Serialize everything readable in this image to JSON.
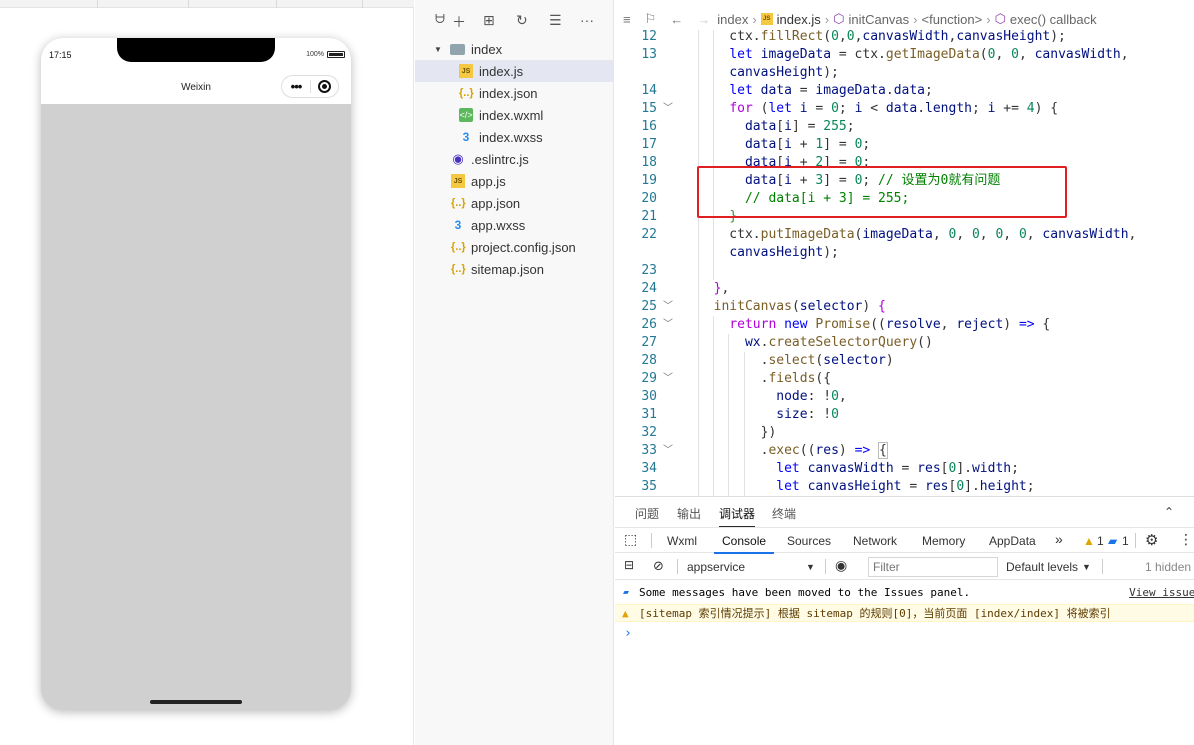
{
  "simulator": {
    "time": "17:15",
    "battery": "100%",
    "nav_title": "Weixin",
    "capsule_more": "•••"
  },
  "explorer": {
    "items": [
      {
        "name": "index",
        "type": "folder"
      },
      {
        "name": "index.js",
        "type": "js",
        "selected": true
      },
      {
        "name": "index.json",
        "type": "json"
      },
      {
        "name": "index.wxml",
        "type": "wxml"
      },
      {
        "name": "index.wxss",
        "type": "wxss"
      },
      {
        "name": ".eslintrc.js",
        "type": "eslint"
      },
      {
        "name": "app.js",
        "type": "js"
      },
      {
        "name": "app.json",
        "type": "json"
      },
      {
        "name": "app.wxss",
        "type": "wxss"
      },
      {
        "name": "project.config.json",
        "type": "json"
      },
      {
        "name": "sitemap.json",
        "type": "json"
      }
    ],
    "icon_labels": {
      "js": "JS",
      "json": "{..}",
      "wxml": "</>",
      "wxss": "3"
    }
  },
  "editor": {
    "breadcrumb": [
      "index",
      "index.js",
      "initCanvas",
      "<function>",
      "exec() callback"
    ],
    "line_numbers": [
      "12",
      "13",
      "",
      "14",
      "15",
      "16",
      "17",
      "18",
      "19",
      "20",
      "21",
      "22",
      "",
      "23",
      "24",
      "25",
      "26",
      "27",
      "28",
      "29",
      "30",
      "31",
      "32",
      "33",
      "34",
      "35"
    ],
    "code": [
      "    ctx.fillRect(0,0,canvasWidth,canvasHeight);",
      "    let imageData = ctx.getImageData(0, 0, canvasWidth,",
      "    canvasHeight);",
      "    let data = imageData.data;",
      "    for (let i = 0; i < data.length; i += 4) {",
      "      data[i] = 255;",
      "      data[i + 1] = 0;",
      "      data[i + 2] = 0;",
      "      data[i + 3] = 0; // 设置为0就有问题",
      "      // data[i + 3] = 255;",
      "    }",
      "    ctx.putImageData(imageData, 0, 0, 0, 0, canvasWidth,",
      "    canvasHeight);",
      "",
      "  },",
      "  initCanvas(selector) {",
      "    return new Promise((resolve, reject) => {",
      "      wx.createSelectorQuery()",
      "        .select(selector)",
      "        .fields({",
      "          node: !0,",
      "          size: !0",
      "        })",
      "        .exec((res) => {",
      "          let canvasWidth = res[0].width;",
      "          let canvasHeight = res[0].height;"
    ]
  },
  "devtools": {
    "tabs": [
      "问题",
      "输出",
      "调试器",
      "终端"
    ],
    "active_tab": "调试器",
    "panels": [
      "Wxml",
      "Console",
      "Sources",
      "Network",
      "Memory",
      "AppData"
    ],
    "active_panel": "Console",
    "warn_count": "1",
    "info_count": "1",
    "context": "appservice",
    "filter_placeholder": "Filter",
    "levels": "Default levels",
    "hidden": "1 hidden",
    "messages": [
      {
        "level": "info",
        "text": "Some messages have been moved to the Issues panel.",
        "link": "View issues"
      },
      {
        "level": "warning",
        "text": "[sitemap 索引情况提示] 根据 sitemap 的规则[0]，当前页面 [index/index] 将被索引"
      }
    ],
    "prompt": "›"
  },
  "colors": {
    "keyword": "#0000ff",
    "comment": "#008000",
    "number": "#098658",
    "line_number": "#237893",
    "highlight_box": "#e02020",
    "selected_row": "#e4e6f1"
  }
}
